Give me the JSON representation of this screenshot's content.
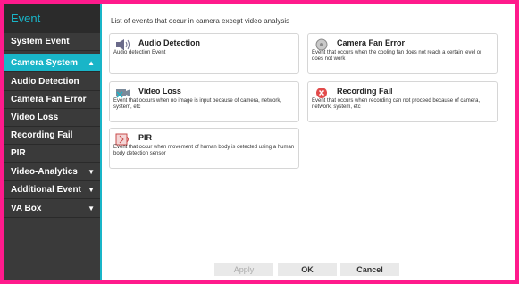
{
  "sidebar": {
    "title": "Event",
    "items": [
      {
        "label": "System Event"
      },
      {
        "label": "Camera System"
      },
      {
        "label": "Audio Detection"
      },
      {
        "label": "Camera Fan Error"
      },
      {
        "label": "Video Loss"
      },
      {
        "label": "Recording Fail"
      },
      {
        "label": "PIR"
      },
      {
        "label": "Video-Analytics"
      },
      {
        "label": "Additional Event"
      },
      {
        "label": "VA Box"
      }
    ]
  },
  "main": {
    "heading": "List of events that occur in camera except video analysis",
    "cards": [
      {
        "title": "Audio Detection",
        "desc": "Audio detection Event"
      },
      {
        "title": "Camera Fan Error",
        "desc": "Event that occurs when the cooling fan does not reach a certain level or does not work"
      },
      {
        "title": "Video Loss",
        "desc": "Event that occurs when no image is input because of camera, network, system, etc"
      },
      {
        "title": "Recording Fail",
        "desc": "Event that occurs when recording can not proceed because of camera, network, system, etc"
      },
      {
        "title": "PIR",
        "desc": "Event that occur when movement of human body is detected using a human body detection sensor"
      }
    ]
  },
  "buttons": {
    "apply": "Apply",
    "ok": "OK",
    "cancel": "Cancel"
  },
  "colors": {
    "accent": "#19b5c8",
    "frame": "#ff1a8c",
    "sidebar": "#3a3a3a"
  }
}
